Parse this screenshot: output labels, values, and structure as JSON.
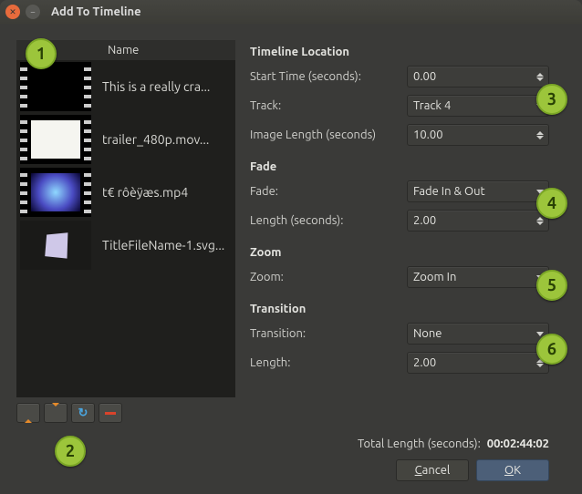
{
  "window": {
    "title": "Add To Timeline"
  },
  "left": {
    "name_header": "Name",
    "files": [
      {
        "label": "This is a really cra..."
      },
      {
        "label": "trailer_480p.mov..."
      },
      {
        "label": "t€ rôèÿæs.mp4"
      },
      {
        "label": "TitleFileName-1.svg..."
      }
    ]
  },
  "sections": {
    "timeline_location": "Timeline Location",
    "fade": "Fade",
    "zoom": "Zoom",
    "transition": "Transition"
  },
  "fields": {
    "start_time_label": "Start Time (seconds):",
    "start_time_value": "0.00",
    "track_label": "Track:",
    "track_value": "Track 4",
    "image_length_label": "Image Length (seconds)",
    "image_length_value": "10.00",
    "fade_label": "Fade:",
    "fade_value": "Fade In & Out",
    "fade_length_label": "Length (seconds):",
    "fade_length_value": "2.00",
    "zoom_label": "Zoom:",
    "zoom_value": "Zoom In",
    "transition_label": "Transition:",
    "transition_value": "None",
    "transition_length_label": "Length:",
    "transition_length_value": "2.00"
  },
  "footer": {
    "total_label": "Total Length (seconds):",
    "total_value": "00:02:44:02",
    "cancel": "Cancel",
    "ok": "OK"
  },
  "markers": {
    "m1": "1",
    "m2": "2",
    "m3": "3",
    "m4": "4",
    "m5": "5",
    "m6": "6"
  }
}
